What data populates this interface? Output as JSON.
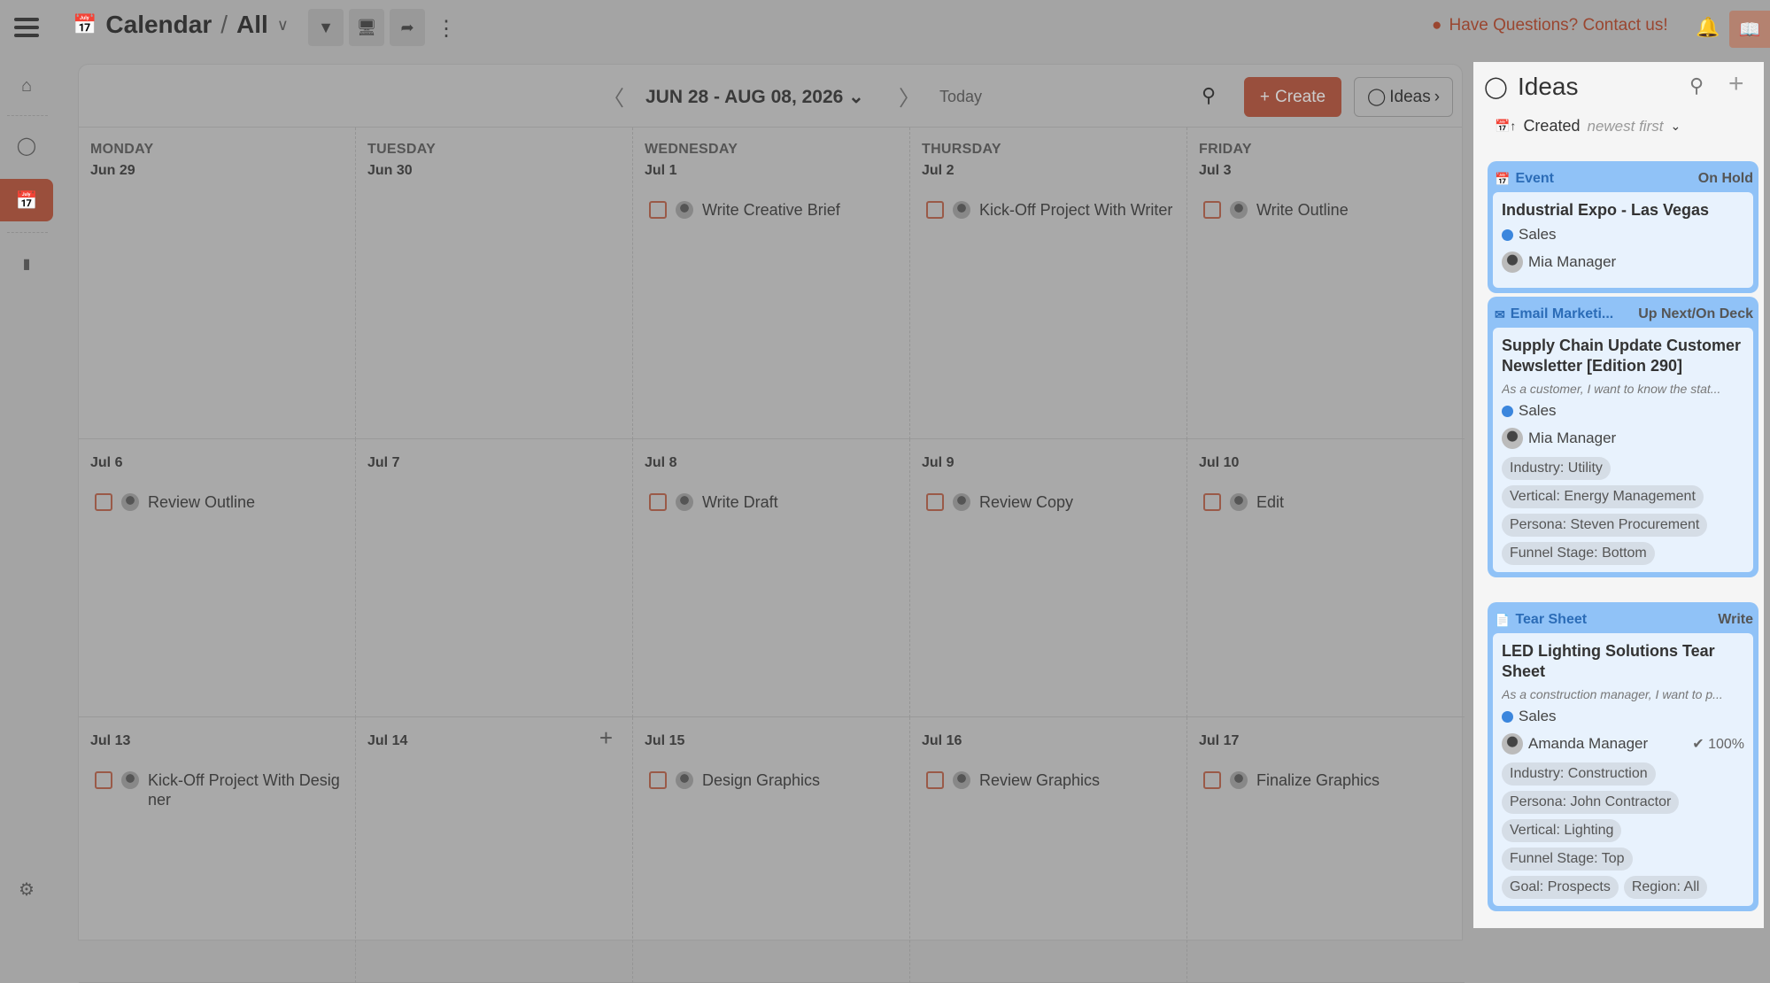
{
  "header": {
    "title": "Calendar",
    "separator": "/",
    "view": "All",
    "contact": "Have Questions? Contact us!"
  },
  "calendar": {
    "range": "JUN 28 - AUG 08, 2026",
    "today": "Today",
    "create": "Create",
    "ideas": "Ideas",
    "weekdays": [
      "MONDAY",
      "TUESDAY",
      "WEDNESDAY",
      "THURSDAY",
      "FRIDAY"
    ],
    "weeks": [
      {
        "days": [
          {
            "date": "Jun 29",
            "task": ""
          },
          {
            "date": "Jun 30",
            "task": ""
          },
          {
            "date": "Jul 1",
            "task": "Write Creative Brief"
          },
          {
            "date": "Jul 2",
            "task": "Kick-Off Project With Writer"
          },
          {
            "date": "Jul 3",
            "task": "Write Outline"
          }
        ]
      },
      {
        "days": [
          {
            "date": "Jul 6",
            "task": "Review Outline"
          },
          {
            "date": "Jul 7",
            "task": ""
          },
          {
            "date": "Jul 8",
            "task": "Write Draft"
          },
          {
            "date": "Jul 9",
            "task": "Review Copy"
          },
          {
            "date": "Jul 10",
            "task": "Edit"
          }
        ]
      },
      {
        "days": [
          {
            "date": "Jul 13",
            "task": "Kick-Off Project With Designer"
          },
          {
            "date": "Jul 14",
            "task": ""
          },
          {
            "date": "Jul 15",
            "task": "Design Graphics"
          },
          {
            "date": "Jul 16",
            "task": "Review Graphics"
          },
          {
            "date": "Jul 17",
            "task": "Finalize Graphics"
          }
        ]
      }
    ]
  },
  "ideas": {
    "title": "Ideas",
    "sort_field": "Created",
    "sort_order": "newest first",
    "cards": [
      {
        "type": "Event",
        "status": "On Hold",
        "title": "Industrial Expo - Las Vegas",
        "description": "",
        "team": "Sales",
        "owner": "Mia Manager",
        "progress": "",
        "tags": []
      },
      {
        "type": "Email Marketi...",
        "status": "Up Next/On Deck",
        "title": "Supply Chain Update Customer Newsletter [Edition 290]",
        "description": "As a customer, I want to know the stat...",
        "team": "Sales",
        "owner": "Mia Manager",
        "progress": "",
        "tags": [
          "Industry: Utility",
          "Vertical: Energy Management",
          "Persona: Steven Procurement",
          "Funnel Stage: Bottom"
        ]
      },
      {
        "type": "Tear Sheet",
        "status": "Write",
        "title": "LED Lighting Solutions Tear Sheet",
        "description": "As a construction manager, I want to p...",
        "team": "Sales",
        "owner": "Amanda Manager",
        "progress": "100%",
        "tags": [
          "Industry: Construction",
          "Persona: John Contractor",
          "Vertical: Lighting",
          "Funnel Stage: Top",
          "Goal: Prospects",
          "Region: All"
        ]
      }
    ]
  },
  "colors": {
    "accent": "#994f3d",
    "card": "#90c2f7",
    "card_body": "#e8f2fd",
    "team_dot": "#3b86dd"
  }
}
